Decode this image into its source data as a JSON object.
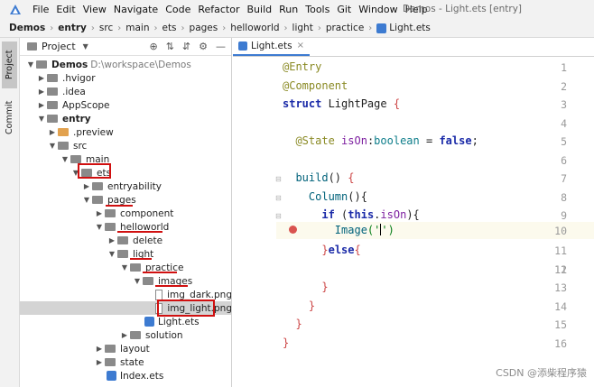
{
  "menubar": {
    "items": [
      "File",
      "Edit",
      "View",
      "Navigate",
      "Code",
      "Refactor",
      "Build",
      "Run",
      "Tools",
      "Git",
      "Window",
      "Help"
    ],
    "window_title": "Demos - Light.ets [entry]"
  },
  "breadcrumb": [
    "Demos",
    "entry",
    "src",
    "main",
    "ets",
    "pages",
    "helloworld",
    "light",
    "practice",
    "Light.ets"
  ],
  "toolstrip": {
    "project_tab": "Project",
    "commit_tab": "Commit"
  },
  "project_panel": {
    "title": "Project",
    "tree": [
      {
        "label": "Demos",
        "note": "D:\\workspace\\Demos"
      },
      {
        "label": ".hvigor"
      },
      {
        "label": ".idea"
      },
      {
        "label": "AppScope"
      },
      {
        "label": "entry"
      },
      {
        "label": ".preview"
      },
      {
        "label": "src"
      },
      {
        "label": "main"
      },
      {
        "label": "ets"
      },
      {
        "label": "entryability"
      },
      {
        "label": "pages"
      },
      {
        "label": "component"
      },
      {
        "label": "helloworld"
      },
      {
        "label": "delete"
      },
      {
        "label": "light"
      },
      {
        "label": "practice"
      },
      {
        "label": "images"
      },
      {
        "label": "img_dark.png"
      },
      {
        "label": "img_light.png"
      },
      {
        "label": "Light.ets"
      },
      {
        "label": "solution"
      },
      {
        "label": "layout"
      },
      {
        "label": "state"
      },
      {
        "label": "Index.ets"
      }
    ]
  },
  "editor": {
    "tab_label": "Light.ets",
    "line_numbers": [
      "1",
      "2",
      "3",
      "4",
      "5",
      "6",
      "7",
      "8",
      "9",
      "10",
      "11",
      "12",
      "13",
      "14",
      "15",
      "16"
    ],
    "code": {
      "l1": "@Entry",
      "l2": "@Component",
      "l3_kw": "struct",
      "l3_name": " LightPage ",
      "l3_brace": "{",
      "l5_deco": "@State",
      "l5_field": " isOn",
      "l5_colon": ":",
      "l5_type": "boolean",
      "l5_eq": " = ",
      "l5_val": "false",
      "l5_semi": ";",
      "l7_fn": "build",
      "l7_rest": "() ",
      "l7_brace": "{",
      "l8_fn": "Column",
      "l8_rest": "(){",
      "l9_if": "if",
      "l9_open": " (",
      "l9_this": "this",
      "l9_dot": ".",
      "l9_field": "isOn",
      "l9_close": "){",
      "l10_fn": "Image",
      "l10_open": "('",
      "l10_close": "')",
      "l11_brace": "}",
      "l11_else": "else",
      "l11_open": "{",
      "l13": "}",
      "l14": "}",
      "l15": "}",
      "l16": "}"
    }
  },
  "watermark": "CSDN @添柴程序猿"
}
